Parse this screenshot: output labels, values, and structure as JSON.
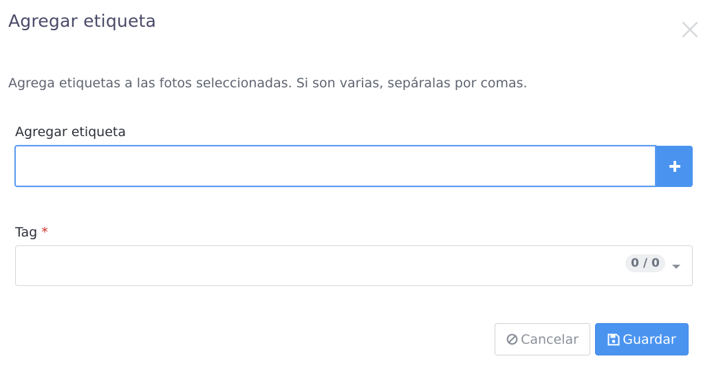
{
  "dialog": {
    "title": "Agregar etiqueta",
    "description": "Agrega etiquetas a las fotos seleccionadas. Si son varias, sepáralas por comas."
  },
  "add_field": {
    "label": "Agregar etiqueta",
    "value": "",
    "placeholder": "",
    "add_button_icon": "plus-icon"
  },
  "tag_field": {
    "label": "Tag",
    "required_marker": "*",
    "counter": "0 / 0",
    "dropdown_icon": "caret-down-icon"
  },
  "footer": {
    "cancel_label": "Cancelar",
    "cancel_icon": "ban-icon",
    "save_label": "Guardar",
    "save_icon": "floppy-disk-icon"
  },
  "colors": {
    "primary": "#4a94f0",
    "focus_border": "#5b9bf0",
    "required": "#d0312d",
    "title": "#4a4a6a"
  }
}
